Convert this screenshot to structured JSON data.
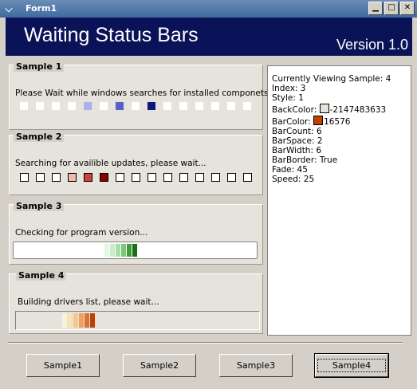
{
  "window": {
    "title": "Form1",
    "menu_glyph": "⌵",
    "min_glyph": "▁",
    "max_glyph": "□",
    "close_glyph": "✕"
  },
  "banner": {
    "title": "Waiting Status Bars",
    "version": "Version 1.0"
  },
  "samples": [
    {
      "header": "Sample 1",
      "message": "Please Wait while windows searches for installed componets..."
    },
    {
      "header": "Sample 2",
      "message": "Searching for availible updates, please wait..."
    },
    {
      "header": "Sample 3",
      "message": "Checking for program version..."
    },
    {
      "header": "Sample 4",
      "message": "Building drivers list, please wait..."
    }
  ],
  "info": {
    "lines": [
      "Currently Viewing Sample: 4",
      "Index: 3",
      "Style: 1",
      "BackColor: -2147483633",
      "BarColor: 16576",
      "BarCount: 6",
      "BarSpace: 2",
      "BarWidth: 6",
      "BarBorder: True",
      "Fade: 45",
      "Speed: 25"
    ],
    "backcolor_label": "BackColor: ",
    "backcolor_value": "-2147483633",
    "barcolor_label": "BarColor: ",
    "barcolor_value": "16576",
    "backcolor_hex": "#e6e3dc",
    "barcolor_hex": "#c04000"
  },
  "buttons": [
    "Sample1",
    "Sample2",
    "Sample3",
    "Sample4"
  ],
  "colors": {
    "banner": "#0b1358",
    "sample1_bar": "#0a1a7a",
    "sample2_bar": "#8b0000",
    "sample3_bar": "#1a6b1a",
    "sample4_bar": "#c04000"
  }
}
